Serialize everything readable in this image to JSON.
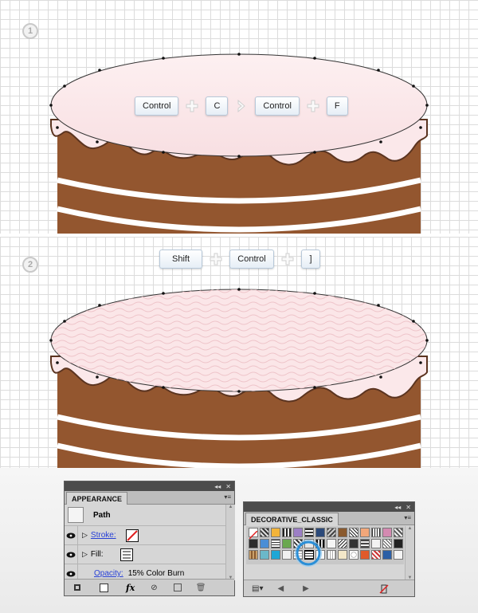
{
  "steps": {
    "one": "1",
    "two": "2"
  },
  "shortcut1": {
    "keys": [
      "Control",
      "C",
      "Control",
      "F"
    ],
    "separators": [
      "plus",
      "chevron",
      "plus"
    ]
  },
  "shortcut2": {
    "keys": [
      "Shift",
      "Control",
      "]"
    ],
    "separators": [
      "plus",
      "plus"
    ]
  },
  "appearance": {
    "tab": "APPEARANCE",
    "object": "Path",
    "stroke_label": "Stroke:",
    "fill_label": "Fill:",
    "opacity_label": "Opacity:",
    "opacity_value": "15% Color Burn",
    "fx_label": "fx"
  },
  "swatches": {
    "tab": "DECORATIVE_CLASSIC"
  },
  "colors": {
    "cake_brown": "#93562f",
    "cake_stripe": "#ffffff",
    "frosting": "#fbe6e8",
    "grid_line": "#dcdcdc",
    "key_border": "#b7c8d9",
    "selection_ring": "#2a8fd8"
  },
  "icons": [
    "close-icon",
    "collapse-arrows-icon",
    "panel-menu-icon",
    "eye-icon",
    "expand-triangle-icon",
    "stroke-none-swatch-icon",
    "fill-swatch-icon",
    "add-stroke-icon",
    "add-fill-icon",
    "fx-icon",
    "clear-icon",
    "duplicate-icon",
    "trash-icon",
    "swatch-libraries-icon",
    "previous-icon",
    "next-icon",
    "none-swatch-icon"
  ]
}
